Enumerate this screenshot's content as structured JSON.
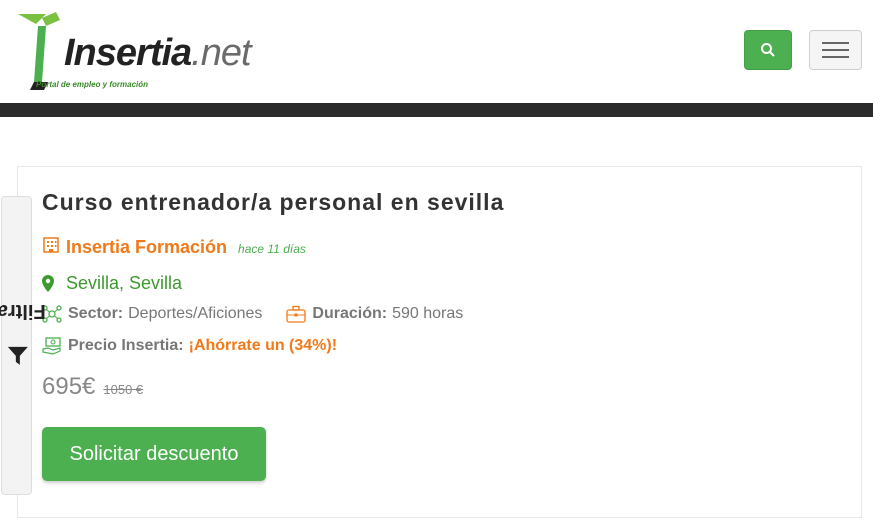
{
  "header": {
    "logo": {
      "brand": "Insertia",
      "tld": ".net",
      "tagline": "Portal de empleo y formación"
    },
    "search_icon": "search-icon",
    "menu_icon": "hamburger-icon"
  },
  "filter": {
    "label": "Filtrar",
    "icon": "funnel-icon"
  },
  "course": {
    "title": "Curso entrenador/a personal en sevilla",
    "company": "Insertia Formación",
    "posted": "hace 11 días",
    "location": "Sevilla, Sevilla",
    "sector_label": "Sector:",
    "sector_value": "Deportes/Aficiones",
    "duration_label": "Duración:",
    "duration_value": "590 horas",
    "price_label": "Precio Insertia:",
    "savings": "¡Ahórrate un (34%)!",
    "price": "695€",
    "old_price": "1050 €",
    "cta_label": "Solicitar descuento"
  },
  "colors": {
    "accent_green": "#4caf50",
    "accent_orange": "#f07a1a",
    "dark_bar": "#2b2b2b"
  }
}
